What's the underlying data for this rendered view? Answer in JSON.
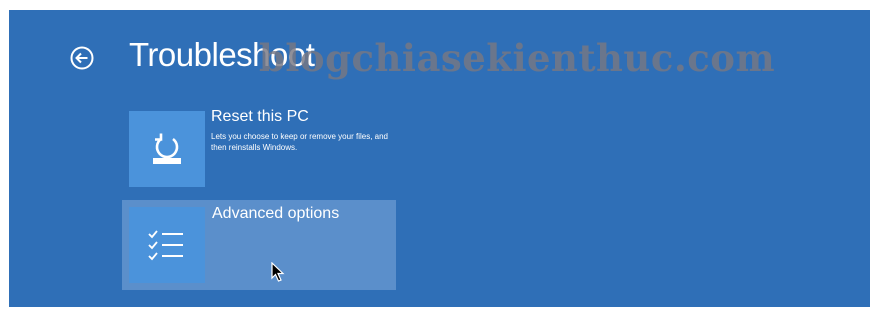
{
  "header": {
    "title": "Troubleshoot",
    "back_icon": "back-arrow-circle-icon"
  },
  "watermark": {
    "text": "blogchiasekienthuc.com"
  },
  "options": [
    {
      "title": "Reset this PC",
      "description": "Lets you choose to keep or remove your files, and then reinstalls Windows.",
      "icon": "reset-pc-icon"
    },
    {
      "title": "Advanced options",
      "icon": "checklist-icon",
      "selected": true
    }
  ],
  "colors": {
    "background": "#2f6fb7",
    "tile_icon": "#4b93db",
    "selected_tile": "#5b8fcb",
    "text": "#ffffff"
  }
}
